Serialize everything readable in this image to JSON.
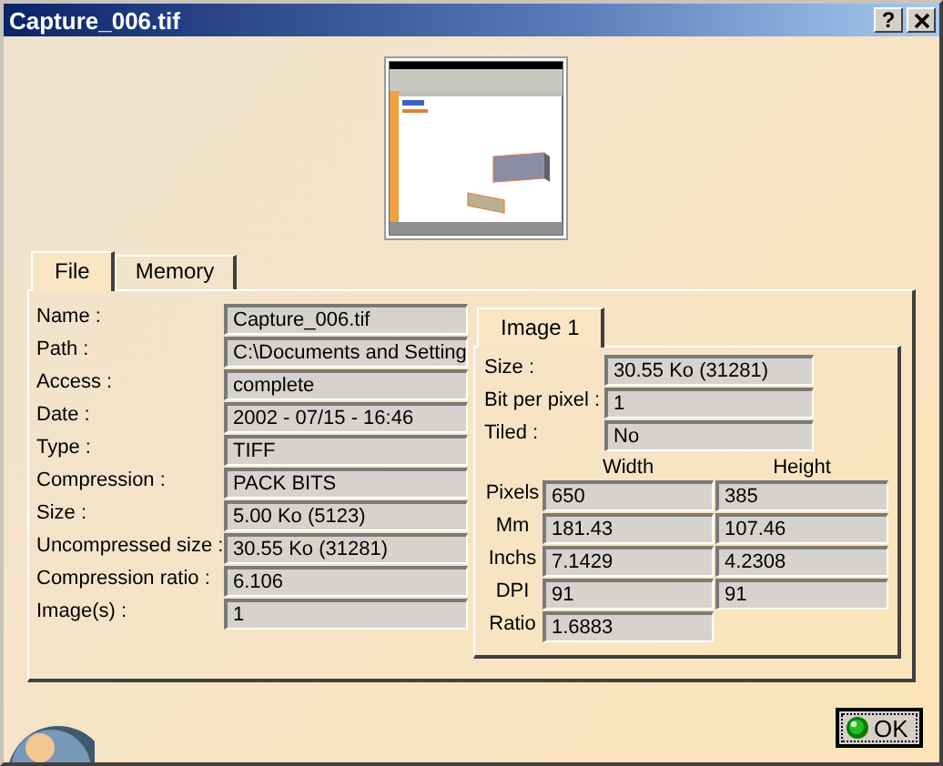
{
  "window": {
    "title": "Capture_006.tif",
    "help_button": "?"
  },
  "tabs": [
    {
      "label": "File",
      "selected": true
    },
    {
      "label": "Memory",
      "selected": false
    }
  ],
  "file_fields": [
    {
      "label": "Name :",
      "value": "Capture_006.tif"
    },
    {
      "label": "Path :",
      "value": "C:\\Documents and Setting"
    },
    {
      "label": "Access :",
      "value": "complete"
    },
    {
      "label": "Date :",
      "value": "2002 - 07/15 - 16:46"
    },
    {
      "label": "Type :",
      "value": "TIFF"
    },
    {
      "label": "Compression :",
      "value": "PACK BITS"
    },
    {
      "label": "Size :",
      "value": "5.00 Ko (5123)"
    },
    {
      "label": "Uncompressed size :",
      "value": "30.55 Ko (31281)"
    },
    {
      "label": "Compression ratio :",
      "value": "6.106"
    },
    {
      "label": "Image(s) :",
      "value": "1"
    }
  ],
  "image_tabs": [
    {
      "label": "Image 1",
      "selected": true
    }
  ],
  "image_fields": [
    {
      "label": "Size :",
      "value": "30.55 Ko (31281)"
    },
    {
      "label": "Bit per pixel :",
      "value": "1"
    },
    {
      "label": "Tiled :",
      "value": "No"
    }
  ],
  "dimensions": {
    "columns": [
      "Width",
      "Height"
    ],
    "rows": [
      {
        "label": "Pixels",
        "values": [
          "650",
          "385"
        ]
      },
      {
        "label": "Mm",
        "values": [
          "181.43",
          "107.46"
        ]
      },
      {
        "label": "Inchs",
        "values": [
          "7.1429",
          "4.2308"
        ]
      },
      {
        "label": "DPI",
        "values": [
          "91",
          "91"
        ]
      },
      {
        "label": "Ratio",
        "values": [
          "1.6883"
        ]
      }
    ]
  },
  "ok_button": "OK"
}
